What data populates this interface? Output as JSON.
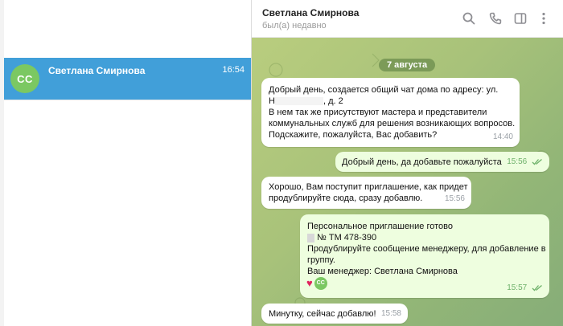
{
  "chat_list": {
    "item": {
      "avatar_initials": "СС",
      "name": "Светлана Смирнова",
      "time": "16:54"
    }
  },
  "header": {
    "name": "Светлана Смирнова",
    "status": "был(а) недавно",
    "icons": [
      "search-icon",
      "phone-icon",
      "sidebar-toggle-icon",
      "more-icon"
    ]
  },
  "chat": {
    "date": "7 августа",
    "messages": [
      {
        "direction": "in",
        "lines": [
          "Добрый день, создается общий чат дома по адресу:  ул.",
          "Н",
          ", д. 2",
          "В нем так же присутствуют мастера и представители",
          "коммунальных служб для решения возникающих вопросов.",
          "Подскажите, пожалуйста, Вас добавить?"
        ],
        "time": "14:40"
      },
      {
        "direction": "out",
        "lines": [
          "Добрый день, да добавьте пожалуйста"
        ],
        "time": "15:56"
      },
      {
        "direction": "in",
        "lines": [
          "Хорошо, Вам поступит приглашение, как придет",
          "продублируйте сюда, сразу добавлю."
        ],
        "time": "15:56"
      },
      {
        "direction": "out",
        "lines": [
          "Персональное приглашение готово",
          "№ ТМ 478-390",
          "Продублируйте сообщение менеджеру, для добавление в",
          "группу.",
          "Ваш менеджер: Светлана Смирнова"
        ],
        "reaction": {
          "emoji": "♥",
          "avatar_initials": "СС"
        },
        "time": "15:57"
      },
      {
        "direction": "in",
        "lines": [
          "Минутку, сейчас добавлю!"
        ],
        "time": "15:58"
      }
    ]
  },
  "colors": {
    "selected": "#419fd9",
    "avatar": "#7bc862",
    "outgoing": "#eefedf",
    "check": "#6eb16a"
  }
}
